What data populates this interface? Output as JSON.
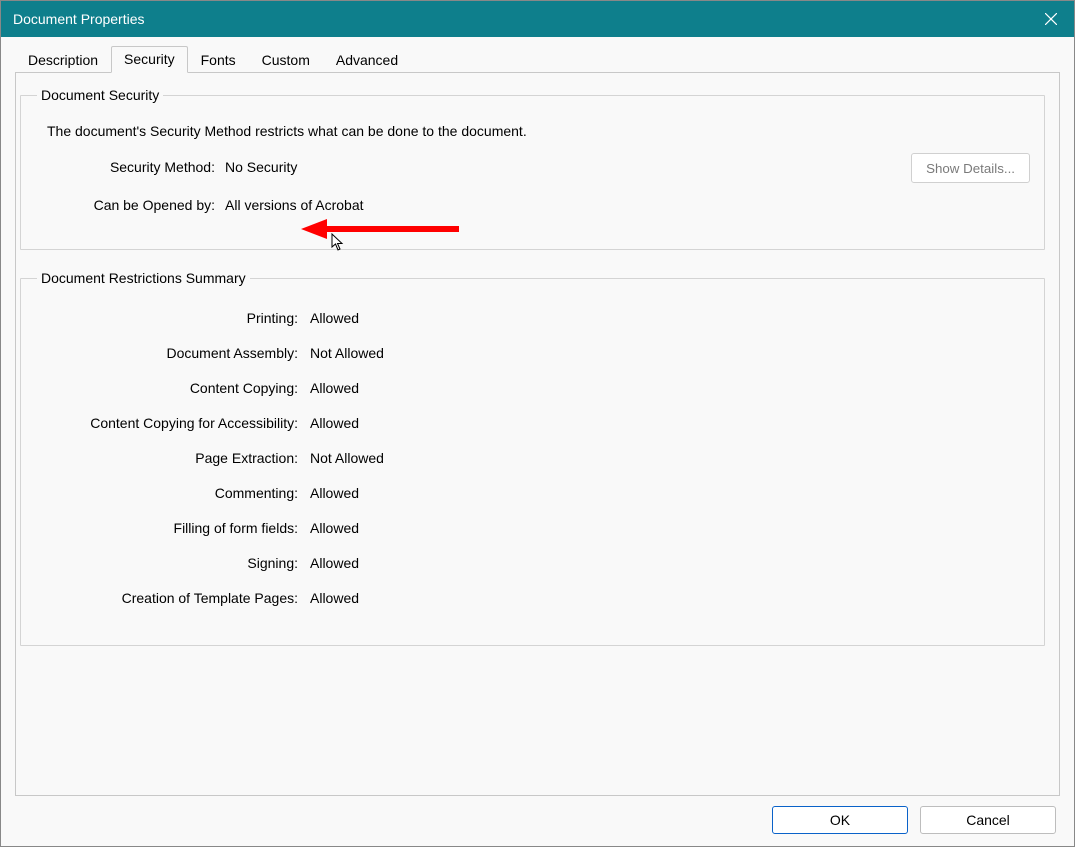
{
  "window": {
    "title": "Document Properties"
  },
  "tabs": {
    "items": [
      {
        "label": "Description"
      },
      {
        "label": "Security"
      },
      {
        "label": "Fonts"
      },
      {
        "label": "Custom"
      },
      {
        "label": "Advanced"
      }
    ],
    "activeIndex": 1
  },
  "security": {
    "groupTitle": "Document Security",
    "description": "The document's Security Method restricts what can be done to the document.",
    "methodLabel": "Security Method:",
    "methodValue": "No Security",
    "openedLabel": "Can be Opened by:",
    "openedValue": "All versions of Acrobat",
    "showDetails": "Show Details..."
  },
  "restrictions": {
    "groupTitle": "Document Restrictions Summary",
    "rows": [
      {
        "label": "Printing:",
        "value": "Allowed"
      },
      {
        "label": "Document Assembly:",
        "value": "Not Allowed"
      },
      {
        "label": "Content Copying:",
        "value": "Allowed"
      },
      {
        "label": "Content Copying for Accessibility:",
        "value": "Allowed"
      },
      {
        "label": "Page Extraction:",
        "value": "Not Allowed"
      },
      {
        "label": "Commenting:",
        "value": "Allowed"
      },
      {
        "label": "Filling of form fields:",
        "value": "Allowed"
      },
      {
        "label": "Signing:",
        "value": "Allowed"
      },
      {
        "label": "Creation of Template Pages:",
        "value": "Allowed"
      }
    ]
  },
  "footer": {
    "ok": "OK",
    "cancel": "Cancel"
  },
  "annotation": {
    "arrowColor": "#ff0000"
  }
}
